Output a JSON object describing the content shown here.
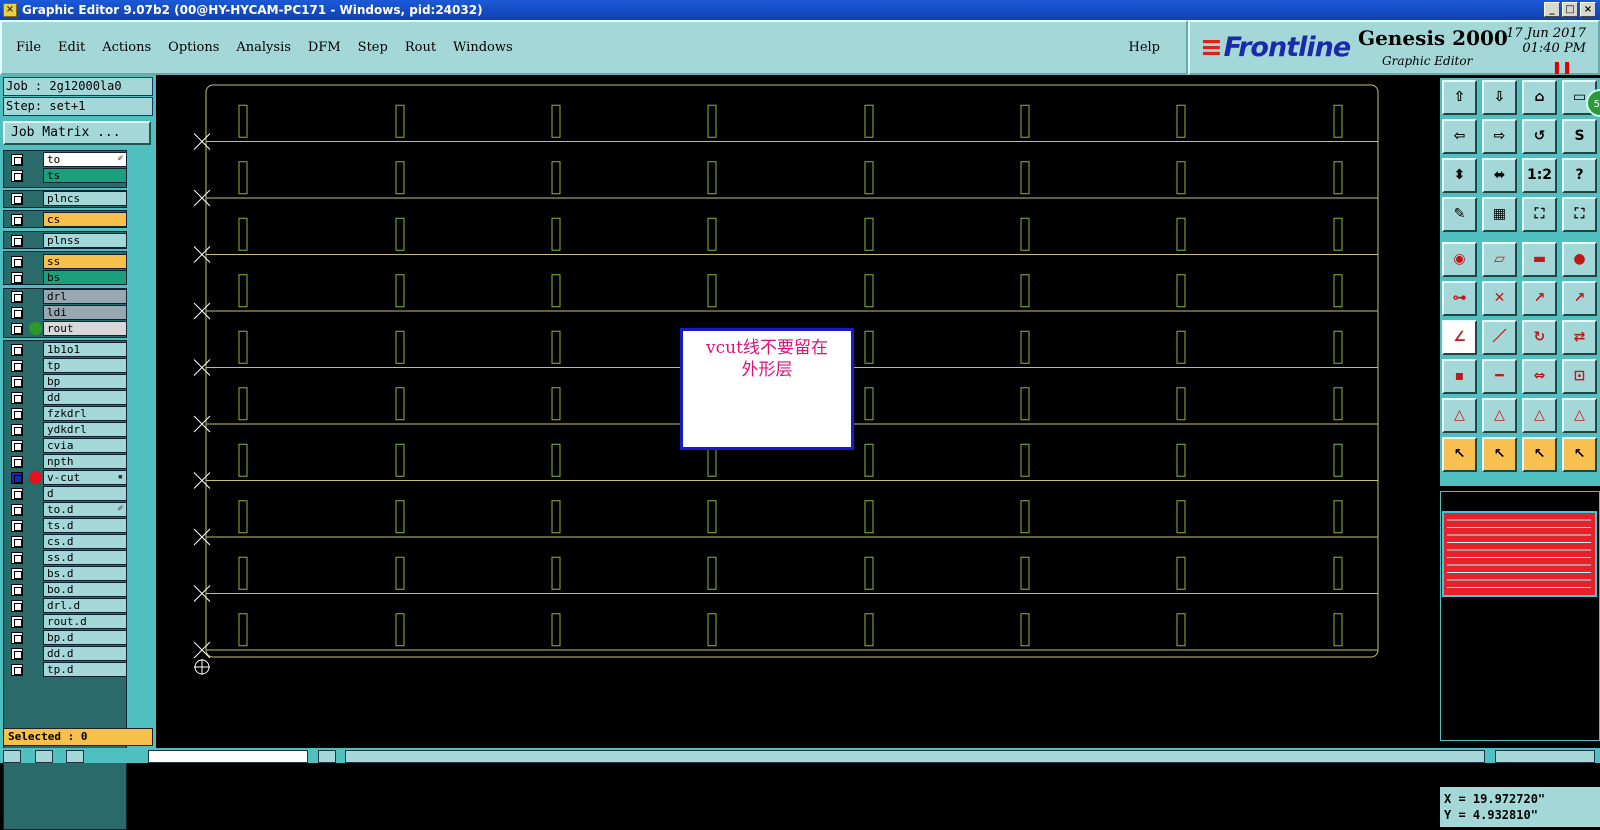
{
  "window": {
    "title": "Graphic Editor 9.07b2 (00@HY-HYCAM-PC171 - Windows, pid:24032)",
    "minimize": "_",
    "maximize": "□",
    "close": "×"
  },
  "menu": [
    "File",
    "Edit",
    "Actions",
    "Options",
    "Analysis",
    "DFM",
    "Step",
    "Rout",
    "Windows"
  ],
  "help": "Help",
  "brand": {
    "logo": "Frontline",
    "product": "Genesis 2000",
    "subtitle": "Graphic Editor",
    "date": "17 Jun 2017",
    "time": "01:40 PM"
  },
  "job": {
    "job_label": "Job : 2g12000la0",
    "step_label": "Step: set+1",
    "job_matrix": "Job Matrix ..."
  },
  "layers": [
    {
      "name": "to",
      "color": "#ffffff",
      "mark": "✐"
    },
    {
      "name": "ts",
      "color": "#1aa07a"
    },
    {
      "name": "plncs",
      "color": "#a4d8d8"
    },
    {
      "name": "cs",
      "color": "#f6c04a"
    },
    {
      "name": "plnss",
      "color": "#a4d8d8"
    },
    {
      "name": "ss",
      "color": "#f6c04a"
    },
    {
      "name": "bs",
      "color": "#1aa07a"
    },
    {
      "name": "drl",
      "color": "#98a8b0"
    },
    {
      "name": "ldi",
      "color": "#98a8b0"
    },
    {
      "name": "rout",
      "color": "#d8d8d8",
      "dot": "#2a9a2a"
    },
    {
      "name": "1b1o1",
      "color": "#a4d8d8"
    },
    {
      "name": "tp",
      "color": "#a4d8d8"
    },
    {
      "name": "bp",
      "color": "#a4d8d8"
    },
    {
      "name": "dd",
      "color": "#a4d8d8"
    },
    {
      "name": "fzkdrl",
      "color": "#a4d8d8"
    },
    {
      "name": "ydkdrl",
      "color": "#a4d8d8"
    },
    {
      "name": "cvia",
      "color": "#a4d8d8"
    },
    {
      "name": "npth",
      "color": "#a4d8d8"
    },
    {
      "name": "v-cut",
      "color": "#a4d8d8",
      "dot": "#e8101a",
      "mark": "▪",
      "active": true
    },
    {
      "name": "d",
      "color": "#a4d8d8"
    },
    {
      "name": "to.d",
      "color": "#a4d8d8",
      "mark": "✐"
    },
    {
      "name": "ts.d",
      "color": "#a4d8d8"
    },
    {
      "name": "cs.d",
      "color": "#a4d8d8"
    },
    {
      "name": "ss.d",
      "color": "#a4d8d8"
    },
    {
      "name": "bs.d",
      "color": "#a4d8d8"
    },
    {
      "name": "bo.d",
      "color": "#a4d8d8"
    },
    {
      "name": "drl.d",
      "color": "#a4d8d8"
    },
    {
      "name": "rout.d",
      "color": "#a4d8d8"
    },
    {
      "name": "bp.d",
      "color": "#a4d8d8"
    },
    {
      "name": "dd.d",
      "color": "#a4d8d8"
    },
    {
      "name": "tp.d",
      "color": "#a4d8d8"
    }
  ],
  "selected": "Selected : 0",
  "note": {
    "line1": "vcut线不要留在",
    "line2": "外形层"
  },
  "coords": {
    "x": "X = 19.972720\"",
    "y": "Y = 4.932810\""
  },
  "badge": "57",
  "colors": {
    "panel": "#4fbfbf",
    "light": "#a4d8d8",
    "board_line": "#c8c070",
    "slot": "#8ab83a",
    "vcut": "#ffffff"
  },
  "tool_icons": [
    "pan-up-icon",
    "pan-down-icon",
    "home-icon",
    "zoom-window-icon",
    "pan-left-icon",
    "pan-right-icon",
    "zoom-back-icon",
    "redraw-icon",
    "zoom-fit-icon",
    "zoom-home-icon",
    "zoom-1to2-icon",
    "help-icon",
    "snap-icon",
    "grid-icon",
    "layers-icon",
    "layers-alt-icon",
    "select-pad-icon",
    "select-line-icon",
    "measure-icon",
    "select-feature-icon",
    "connect-icon",
    "delete-icon",
    "move-point-icon",
    "move-pair-icon",
    "angle-icon",
    "line-icon",
    "rotate-icon",
    "mirror-icon",
    "pad-add-icon",
    "line-add-icon",
    "dimension-icon",
    "copy-icon",
    "triangle-1-icon",
    "triangle-2-icon",
    "triangle-3-icon",
    "triangle-4-icon",
    "pointer-icon",
    "pointer-box-icon",
    "pointer-circle-icon",
    "pointer-path-icon"
  ]
}
